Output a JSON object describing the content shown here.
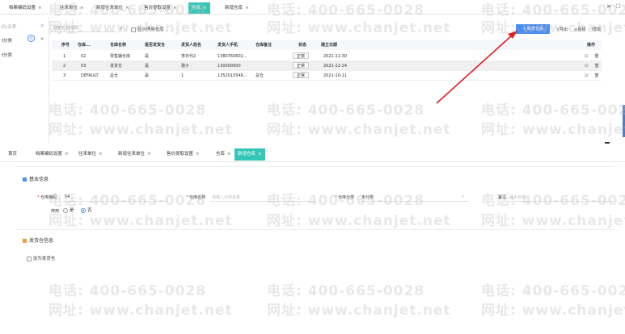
{
  "top": {
    "tabs": [
      {
        "label": "档案编码设置",
        "closable": true
      },
      {
        "label": "往来单位",
        "closable": true
      },
      {
        "label": "新增往来单位",
        "closable": true
      },
      {
        "label": "售价提取设置",
        "closable": true
      },
      {
        "label": "仓库",
        "closable": true,
        "active": true
      },
      {
        "label": "新增仓库",
        "closable": true
      }
    ],
    "close_symbol": "×",
    "window_close": "×",
    "window_expand": "⛶"
  },
  "left_nav": {
    "items": [
      "码/名称",
      "f分类",
      "f分类"
    ],
    "collapse_symbol": "«"
  },
  "search": {
    "placeholder": "搜索名称/编码"
  },
  "show_disabled_label": "显示停用仓库",
  "toolbar": {
    "add_label": "+ 新增仓库",
    "export_label": "导出",
    "video_label": "视频",
    "help_label": "帮助"
  },
  "table": {
    "headers": [
      "序号",
      "仓库...",
      "仓库名称",
      "是否发货仓",
      "发货人姓名",
      "发货人手机",
      "仓库备注",
      "状态",
      "建立日期",
      "操作"
    ],
    "rows": [
      {
        "no": "1",
        "code": "02",
        "name": "零售辅仓库",
        "is_ship": "是",
        "shipper": "李日代2",
        "phone": "1380760602...",
        "remark": "",
        "status": "正常",
        "date": "2021-11-30"
      },
      {
        "no": "2",
        "code": "03",
        "name": "发货仓",
        "is_ship": "是",
        "shipper": "骆子",
        "phone": "130000000",
        "remark": "",
        "status": "正常",
        "date": "2021-12-24"
      },
      {
        "no": "3",
        "code": "DEFAULT",
        "name": "总仓",
        "is_ship": "是",
        "shipper": "1",
        "phone": "1352015546...",
        "remark": "总仓",
        "status": "正常",
        "date": "2021-10-11"
      }
    ],
    "edit_icon": "☑",
    "delete_icon": "🗑"
  },
  "watermark": {
    "phone": "电话: 400-665-0028",
    "site": "网址: www.chanjet.net"
  },
  "bottom": {
    "tabs": [
      {
        "label": "首页",
        "closable": false
      },
      {
        "label": "档案编码设置",
        "closable": true
      },
      {
        "label": "往来单位",
        "closable": true
      },
      {
        "label": "新增往来单位",
        "closable": true
      },
      {
        "label": "售价提取设置",
        "closable": true
      },
      {
        "label": "仓库",
        "closable": true
      },
      {
        "label": "新增仓库",
        "closable": true,
        "active": true
      }
    ],
    "basic_section": "基本信息",
    "code_label": "仓库编码",
    "code_value": "04",
    "name_label": "仓库名称",
    "name_placeholder": "请输入仓库名称",
    "category_label": "仓库分类",
    "category_value": "未分类",
    "remark_label": "备注",
    "remark_placeholder": "最大长度",
    "enable_label": "停用",
    "yes_label": "是",
    "no_label": "否",
    "ship_section": "发货仓信息",
    "set_ship_label": "设为发货仓"
  },
  "colors": {
    "accent": "#35c6b7",
    "primary_button": "#4a8ef0",
    "arrow": "#e02020"
  }
}
